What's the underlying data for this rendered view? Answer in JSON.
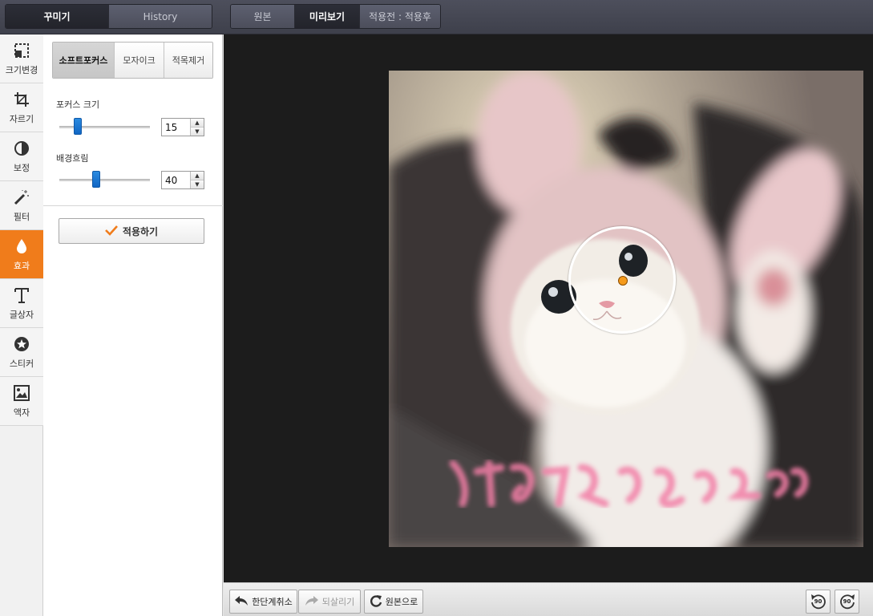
{
  "top_tabs": {
    "decorate_label": "꾸미기",
    "history_label": "History"
  },
  "view_tabs": {
    "original_label": "원본",
    "preview_label": "미리보기",
    "compare_label": "적용전 : 적용후"
  },
  "tools": [
    {
      "label": "크기변경",
      "icon": "resize-icon"
    },
    {
      "label": "자르기",
      "icon": "crop-icon"
    },
    {
      "label": "보정",
      "icon": "adjust-icon"
    },
    {
      "label": "필터",
      "icon": "magic-wand-icon"
    },
    {
      "label": "효과",
      "icon": "drop-icon",
      "active": true
    },
    {
      "label": "글상자",
      "icon": "text-icon"
    },
    {
      "label": "스티커",
      "icon": "star-icon"
    },
    {
      "label": "액자",
      "icon": "frame-icon"
    }
  ],
  "effect_tabs": {
    "softfocus_label": "소프트포커스",
    "mosaic_label": "모자이크",
    "redeye_label": "적목제거"
  },
  "options": {
    "focus_size_label": "포커스 크기",
    "focus_size_value": "15",
    "focus_size_fraction": 0.17,
    "blur_label": "배경흐림",
    "blur_value": "40",
    "blur_fraction": 0.4
  },
  "apply_button_label": "적용하기",
  "bottom_bar": {
    "undo_label": "한단계취소",
    "redo_label": "되살리기",
    "reset_label": "원본으로",
    "rotate_left_label": "90",
    "rotate_right_label": "90"
  },
  "colors": {
    "accent": "#f07c1b",
    "slider_thumb": "#1a73d1",
    "focus_dot": "#f59a1b"
  }
}
